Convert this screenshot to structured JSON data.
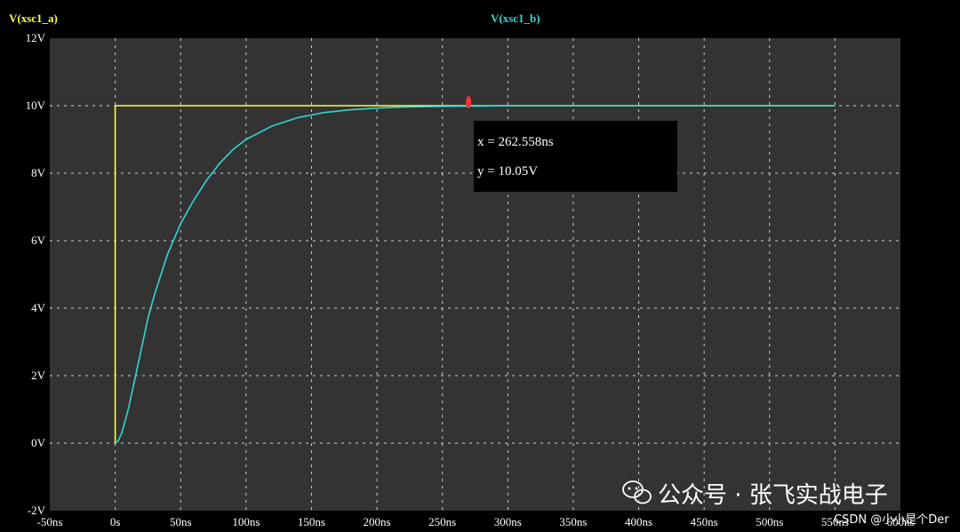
{
  "colors": {
    "background": "#000000",
    "plot_area": "#333333",
    "grid": "#d0d0d0",
    "trace_a": "#ffff33",
    "trace_b": "#33d6d6",
    "cursor": "#ff3333",
    "readout_bg": "#000000",
    "text": "#ffffff"
  },
  "chart_data": {
    "type": "line",
    "title": "",
    "xlabel": "",
    "ylabel": "",
    "xlim": [
      -50,
      600
    ],
    "ylim": [
      -2,
      12
    ],
    "grid": true,
    "x_unit": "ns",
    "y_unit": "V",
    "x_ticks": [
      -50,
      0,
      50,
      100,
      150,
      200,
      250,
      300,
      350,
      400,
      450,
      500,
      550,
      600
    ],
    "x_tick_labels": [
      "-50ns",
      "0s",
      "50ns",
      "100ns",
      "150ns",
      "200ns",
      "250ns",
      "300ns",
      "350ns",
      "400ns",
      "450ns",
      "500ns",
      "550ns",
      "600ns"
    ],
    "y_ticks": [
      -2,
      0,
      2,
      4,
      6,
      8,
      10,
      12
    ],
    "y_tick_labels": [
      "-2V",
      "0V",
      "2V",
      "4V",
      "6V",
      "8V",
      "10V",
      "12V"
    ],
    "series": [
      {
        "name": "V(xsc1_a)",
        "color": "#ffff33",
        "x": [
          0,
          0,
          550
        ],
        "y": [
          0,
          10,
          10
        ]
      },
      {
        "name": "V(xsc1_b)",
        "color": "#33d6d6",
        "x": [
          0,
          2,
          5,
          10,
          15,
          20,
          25,
          30,
          40,
          50,
          60,
          70,
          80,
          90,
          100,
          120,
          140,
          160,
          180,
          200,
          220,
          250,
          280,
          300,
          350,
          400,
          450,
          500,
          550
        ],
        "y": [
          0,
          0.05,
          0.3,
          1.0,
          1.9,
          2.8,
          3.7,
          4.4,
          5.6,
          6.5,
          7.2,
          7.8,
          8.3,
          8.7,
          9.0,
          9.4,
          9.65,
          9.8,
          9.88,
          9.93,
          9.96,
          9.98,
          9.99,
          10.0,
          10.0,
          10.0,
          10.0,
          10.0,
          10.0
        ]
      }
    ],
    "cursor": {
      "x": 270,
      "y": 10.05
    },
    "readout": {
      "x_text": "x = 262.558ns",
      "y_text": "y = 10.05V"
    }
  },
  "watermark": {
    "main": "公众号 · 张飞实战电子",
    "sub": "CSDN @小小是个Der"
  }
}
